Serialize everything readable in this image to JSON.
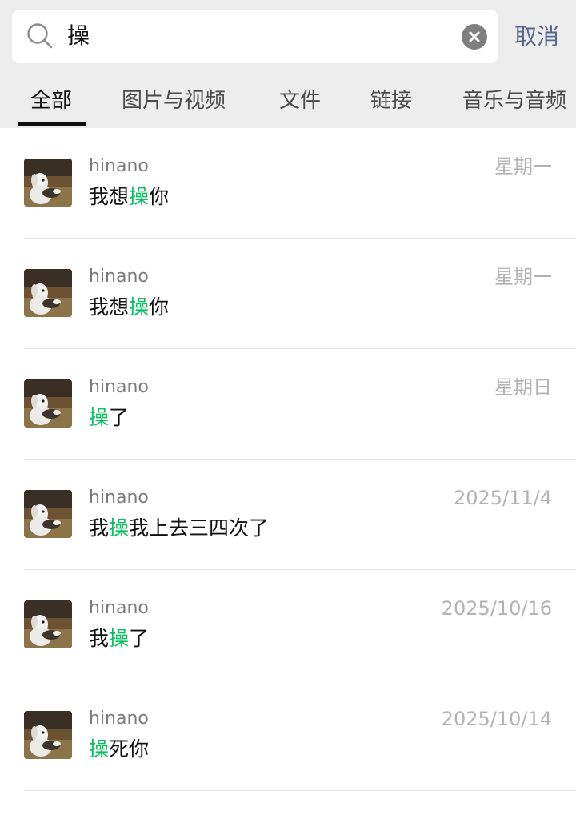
{
  "search": {
    "query": "操",
    "cancel_label": "取消"
  },
  "tabs": [
    {
      "label": "全部",
      "active": true
    },
    {
      "label": "图片与视频",
      "active": false
    },
    {
      "label": "文件",
      "active": false
    },
    {
      "label": "链接",
      "active": false
    },
    {
      "label": "音乐与音频",
      "active": false
    }
  ],
  "results": [
    {
      "sender": "hinano",
      "time": "星期一",
      "before": "我想",
      "match": "操",
      "after": "你"
    },
    {
      "sender": "hinano",
      "time": "星期一",
      "before": "我想",
      "match": "操",
      "after": "你"
    },
    {
      "sender": "hinano",
      "time": "星期日",
      "before": "",
      "match": "操",
      "after": "了"
    },
    {
      "sender": "hinano",
      "time": "2025/11/4",
      "before": "我",
      "match": "操",
      "after": "我上去三四次了"
    },
    {
      "sender": "hinano",
      "time": "2025/10/16",
      "before": "我",
      "match": "操",
      "after": "了"
    },
    {
      "sender": "hinano",
      "time": "2025/10/14",
      "before": "",
      "match": "操",
      "after": "死你"
    }
  ],
  "colors": {
    "highlight": "#07c160",
    "cancel": "#57688d",
    "header_bg": "#ededed"
  },
  "icons": [
    "search-icon",
    "clear-icon",
    "avatar-puppy"
  ]
}
